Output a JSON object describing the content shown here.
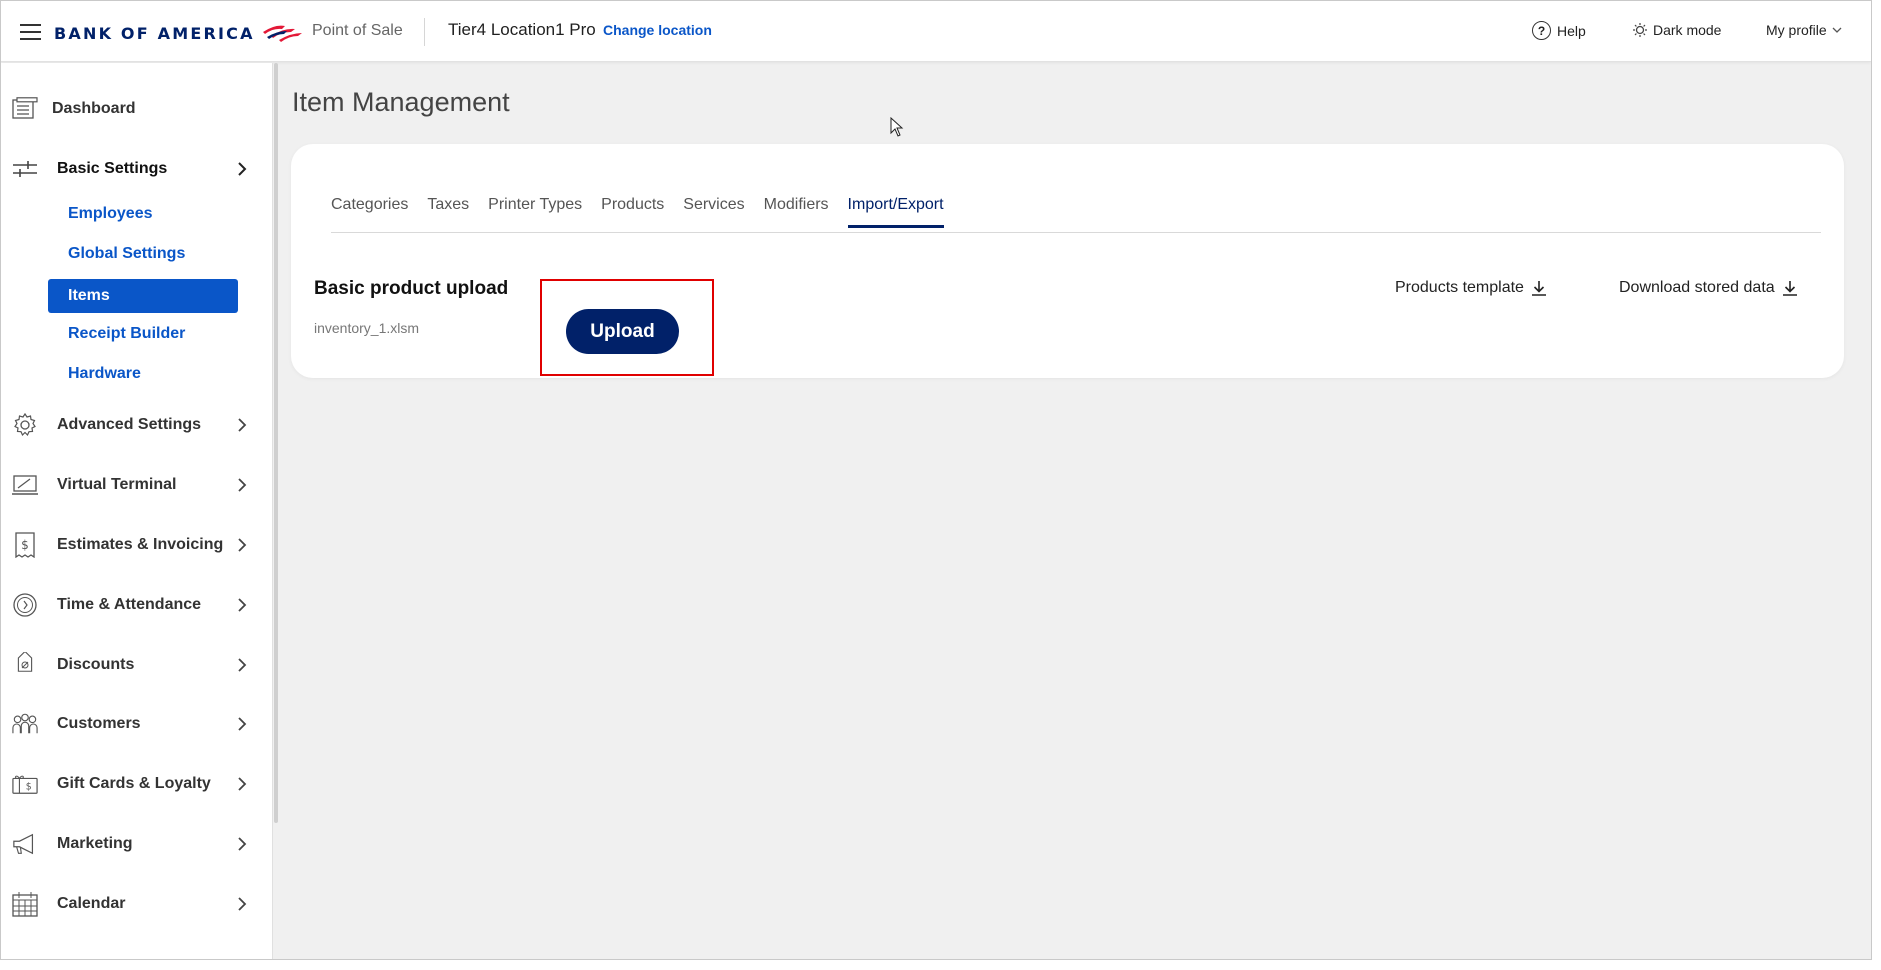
{
  "header": {
    "brand": "BANK OF AMERICA",
    "product": "Point of Sale",
    "location": "Tier4 Location1 Pro",
    "change_location": "Change location",
    "help": "Help",
    "dark_mode": "Dark mode",
    "profile": "My profile"
  },
  "sidebar": {
    "items": [
      {
        "label": "Dashboard",
        "icon": "dashboard-icon"
      },
      {
        "label": "Basic Settings",
        "icon": "sliders-icon"
      },
      {
        "label": "Advanced Settings",
        "icon": "gear-icon"
      },
      {
        "label": "Virtual Terminal",
        "icon": "terminal-icon"
      },
      {
        "label": "Estimates & Invoicing",
        "icon": "invoice-icon"
      },
      {
        "label": "Time & Attendance",
        "icon": "clock-icon"
      },
      {
        "label": "Discounts",
        "icon": "tag-icon"
      },
      {
        "label": "Customers",
        "icon": "people-icon"
      },
      {
        "label": "Gift Cards & Loyalty",
        "icon": "gift-card-icon"
      },
      {
        "label": "Marketing",
        "icon": "megaphone-icon"
      },
      {
        "label": "Calendar",
        "icon": "calendar-icon"
      }
    ],
    "basic_settings_sub": [
      "Employees",
      "Global Settings",
      "Items",
      "Receipt Builder",
      "Hardware"
    ],
    "active_sub": "Items"
  },
  "main": {
    "title": "Item Management",
    "tabs": [
      "Categories",
      "Taxes",
      "Printer Types",
      "Products",
      "Services",
      "Modifiers",
      "Import/Export"
    ],
    "active_tab": "Import/Export",
    "upload_title": "Basic product upload",
    "file_name": "inventory_1.xlsm",
    "upload_button": "Upload",
    "products_template": "Products template",
    "download_stored": "Download stored data"
  },
  "colors": {
    "brand_navy": "#012169",
    "link_blue": "#0a56c8",
    "brand_red": "#e31837",
    "highlight_red": "#e00000"
  }
}
